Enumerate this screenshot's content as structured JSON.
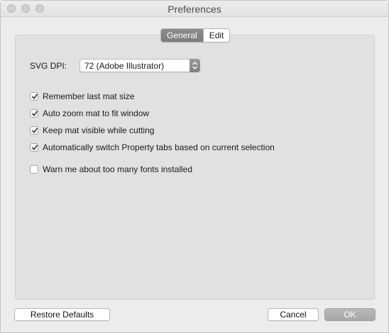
{
  "window": {
    "title": "Preferences"
  },
  "tabs": [
    {
      "label": "General",
      "active": true
    },
    {
      "label": "Edit",
      "active": false
    }
  ],
  "svg_dpi": {
    "label": "SVG DPI:",
    "selected": "72 (Adobe Illustrator)"
  },
  "options": [
    {
      "label": "Remember last mat size",
      "checked": true
    },
    {
      "label": "Auto zoom mat to fit window",
      "checked": true
    },
    {
      "label": "Keep mat visible while cutting",
      "checked": true
    },
    {
      "label": "Automatically switch Property tabs based on current selection",
      "checked": true
    },
    {
      "label": "Warn me about too many fonts installed",
      "checked": false
    }
  ],
  "buttons": {
    "restore": "Restore Defaults",
    "cancel": "Cancel",
    "ok": "OK"
  },
  "colors": {
    "window_bg": "#ececec",
    "panel_bg": "#e1e1e1",
    "active_tab": "#848484",
    "ok_button": "#b0b0b0"
  }
}
